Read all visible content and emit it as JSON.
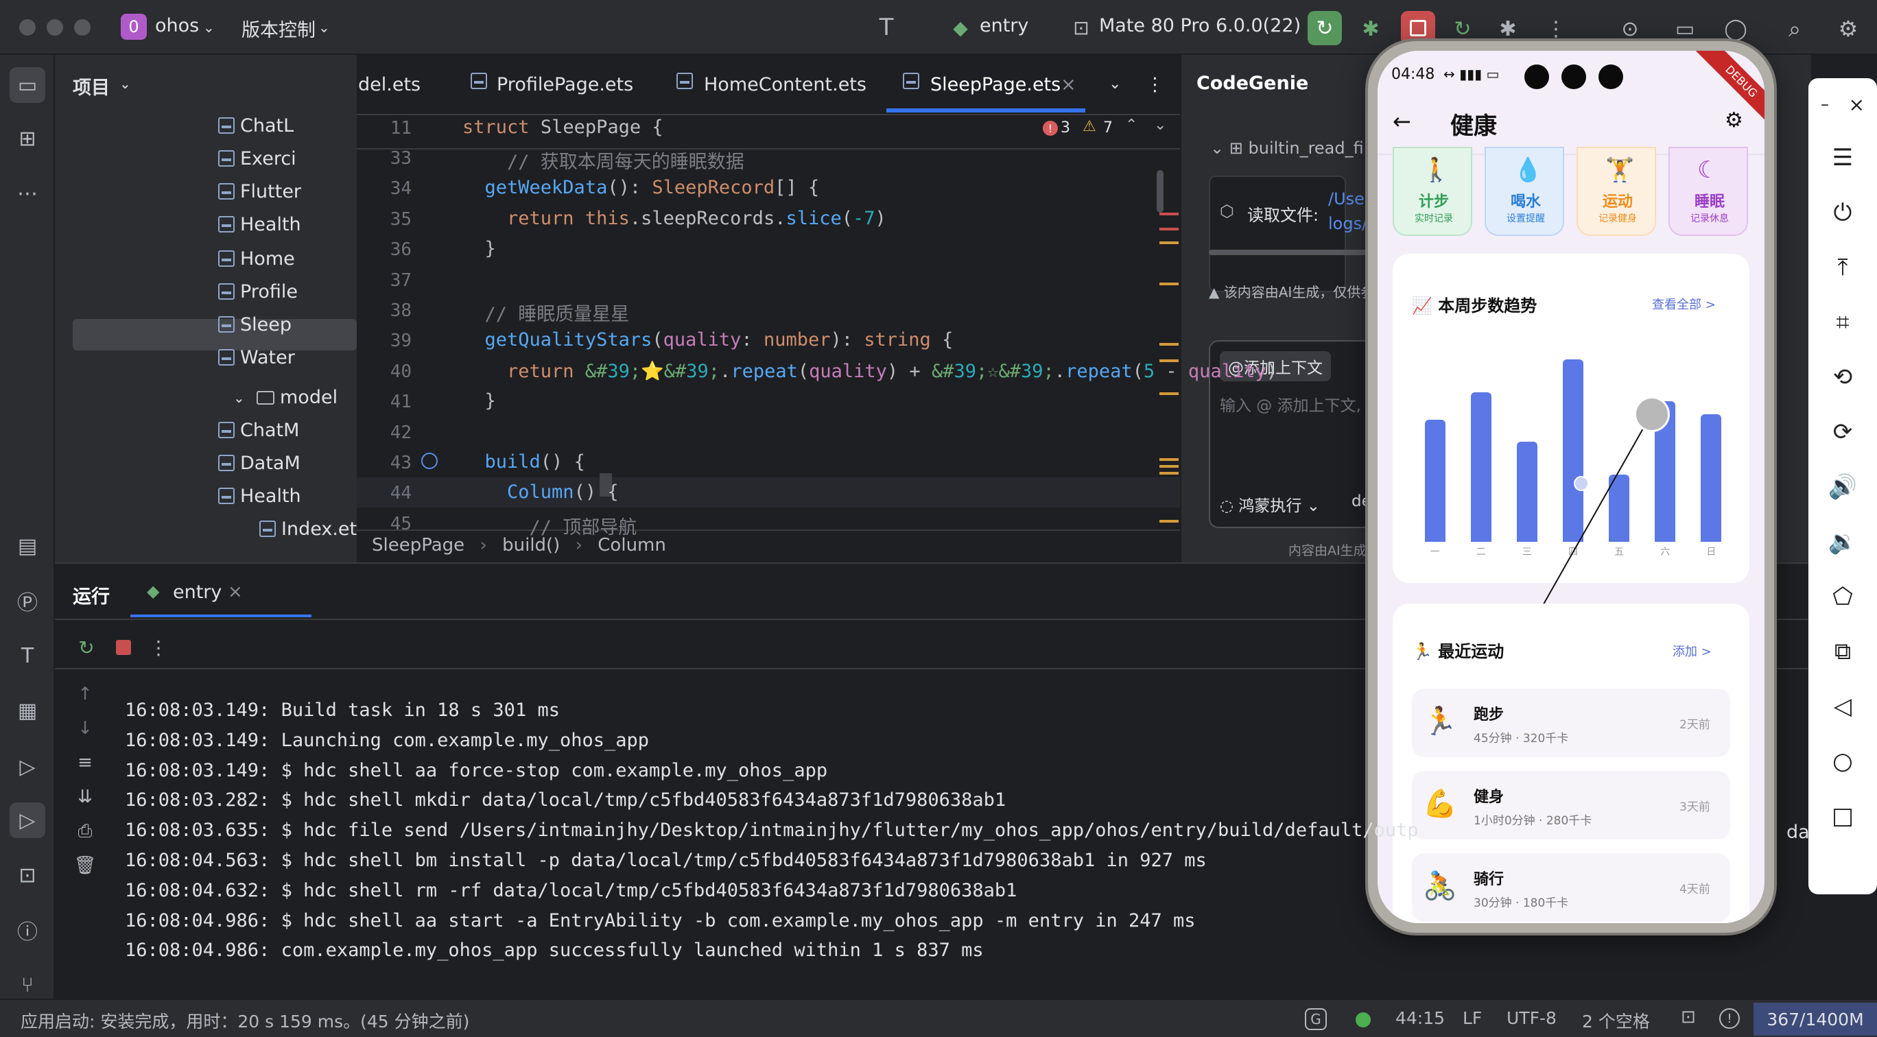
{
  "titlebar": {
    "project_badge": "0",
    "project_name": "ohos",
    "vcs": "版本控制",
    "run_config": "entry",
    "device": "Mate 80 Pro 6.0.0(22)"
  },
  "project_panel": {
    "title": "项目",
    "items": [
      "ChatL",
      "Exerci",
      "Flutter",
      "Health",
      "Home",
      "Profile",
      "Sleep",
      "Water"
    ],
    "folder": "model",
    "model_items": [
      "ChatM",
      "DataM",
      "Health"
    ],
    "index": "Index.ets"
  },
  "editor": {
    "tabs": [
      "del.ets",
      "ProfilePage.ets",
      "HomeContent.ets",
      "SleepPage.ets"
    ],
    "sticky_line": "11",
    "sticky": {
      "kw": "struct",
      "name": "SleepPage",
      "brace": "{"
    },
    "errors": "3",
    "warnings": "7",
    "lines": [
      {
        "n": "33",
        "c": "    // 获取本周每天的睡眠数据"
      },
      {
        "n": "34",
        "c": "  getWeekData(): SleepRecord[] {"
      },
      {
        "n": "35",
        "c": "    return this.sleepRecords.slice(-7)"
      },
      {
        "n": "36",
        "c": "  }"
      },
      {
        "n": "37",
        "c": ""
      },
      {
        "n": "38",
        "c": "  // 睡眠质量星星"
      },
      {
        "n": "39",
        "c": "  getQualityStars(quality: number): string {"
      },
      {
        "n": "40",
        "c": "    return '⭐'.repeat(quality) + '☆'.repeat(5 - quality)"
      },
      {
        "n": "41",
        "c": "  }"
      },
      {
        "n": "42",
        "c": ""
      },
      {
        "n": "43",
        "c": "  build() {"
      },
      {
        "n": "44",
        "c": "    Column() {"
      },
      {
        "n": "45",
        "c": "      // 顶部导航"
      }
    ],
    "breadcrumb": [
      "SleepPage",
      "build()",
      "Column"
    ]
  },
  "codegenie": {
    "title": "CodeGenie",
    "tool": "builtin_read_fi",
    "read_label": "读取文件:",
    "path1": "/User",
    "path2": "logs/",
    "disclaimer": "该内容由AI生成，仅供参",
    "add_context": "@添加上下文",
    "input_placeholder": "输入 @ 添加上下文,",
    "mode": "鸿蒙执行",
    "model": "de",
    "footer": "内容由AI生成"
  },
  "run": {
    "tab_title": "运行",
    "config": "entry",
    "log": [
      "16:08:03.149: Build task in 18 s 301 ms",
      "16:08:03.149: Launching com.example.my_ohos_app",
      "16:08:03.149: $ hdc shell aa force-stop com.example.my_ohos_app",
      "16:08:03.282: $ hdc shell mkdir data/local/tmp/c5fbd40583f6434a873f1d7980638ab1",
      "16:08:03.635: $ hdc file send /Users/intmainjhy/Desktop/intmainjhy/flutter/my_ohos_app/ohos/entry/build/default/outp",
      "16:08:04.563: $ hdc shell bm install -p data/local/tmp/c5fbd40583f6434a873f1d7980638ab1 in 927 ms",
      "16:08:04.632: $ hdc shell rm -rf data/local/tmp/c5fbd40583f6434a873f1d7980638ab1",
      "16:08:04.986: $ hdc shell aa start -a EntryAbility -b com.example.my_ohos_app -m entry in 247 ms",
      "16:08:04.986: com.example.my_ohos_app successfully launched within 1 s 837 ms"
    ],
    "overflow_text": "data"
  },
  "status": {
    "message": "应用启动: 安装完成，用时：20 s 159 ms。(45 分钟之前)",
    "position": "44:15",
    "line_sep": "LF",
    "encoding": "UTF-8",
    "indent": "2 个空格",
    "memory": "367/1400M"
  },
  "phone": {
    "time": "04:48",
    "debug": "DEBUG",
    "title": "健康",
    "quick": [
      {
        "label": "计步",
        "sub": "实时记录",
        "color": "#2e9e55",
        "bg": "#e3f4e8"
      },
      {
        "label": "喝水",
        "sub": "设置提醒",
        "color": "#2b7fd6",
        "bg": "#e1edfb"
      },
      {
        "label": "运动",
        "sub": "记录健身",
        "color": "#f08c1a",
        "bg": "#fdf0e0"
      },
      {
        "label": "睡眠",
        "sub": "记录休息",
        "color": "#9b3fc6",
        "bg": "#f3e3f8"
      }
    ],
    "steps_title": "📈 本周步数趋势",
    "steps_link": "查看全部 >",
    "chart_data": {
      "type": "bar",
      "categories": [
        "一",
        "二",
        "三",
        "四",
        "五",
        "六",
        "日"
      ],
      "values": [
        0.67,
        0.82,
        0.55,
        1.0,
        0.37,
        0.77,
        0.7
      ],
      "title": "本周步数趋势"
    },
    "recent_title": "🏃 最近运动",
    "recent_link": "添加 >",
    "activities": [
      {
        "icon": "🏃",
        "name": "跑步",
        "detail": "45分钟 · 320千卡",
        "when": "2天前"
      },
      {
        "icon": "💪",
        "name": "健身",
        "detail": "1小时0分钟 · 280千卡",
        "when": "3天前"
      },
      {
        "icon": "🚴",
        "name": "骑行",
        "detail": "30分钟 · 180千卡",
        "when": "4天前"
      }
    ]
  }
}
